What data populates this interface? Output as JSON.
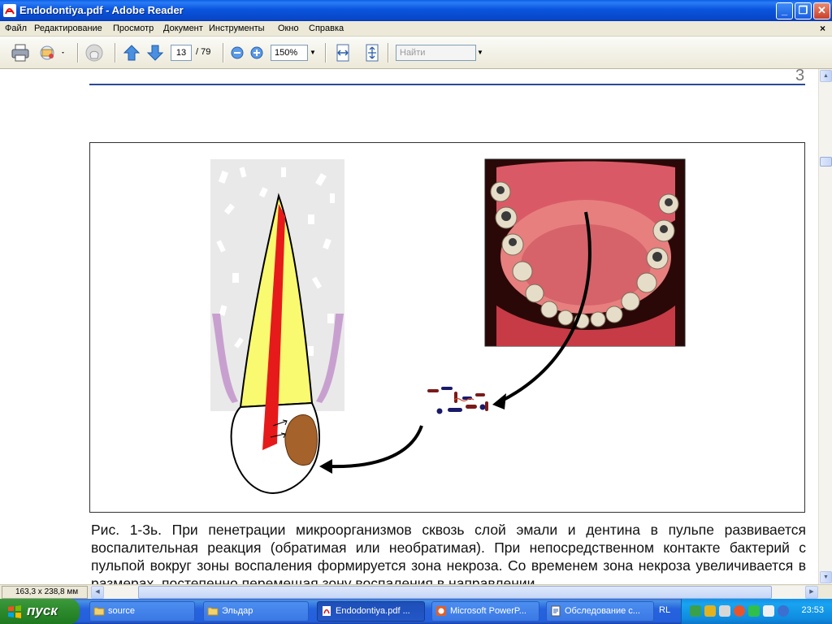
{
  "window": {
    "title": "Endodontiya.pdf - Adobe Reader",
    "buttons": {
      "minimize": "_",
      "maximize": "❐",
      "close": "✕"
    }
  },
  "menu": {
    "items": [
      "Файл",
      "Редактирование",
      "Просмотр",
      "Документ",
      "Инструменты",
      "Окно",
      "Справка"
    ],
    "close": "×"
  },
  "toolbar": {
    "page_current": "13",
    "page_total": "/ 79",
    "zoom": "150%",
    "find_placeholder": "Найти",
    "icons": [
      "printer-icon",
      "email-icon",
      "hand-tool-icon",
      "previous-page-icon",
      "next-page-icon",
      "zoom-out-icon",
      "zoom-in-icon",
      "fit-width-icon",
      "fit-page-icon"
    ]
  },
  "document": {
    "page_number": "3",
    "caption": "Рис. 1-3ь. При пенетрации микроорганизмов сквозь слой эмали и дентина в пульпе развивается воспалительная реакция (обратимая или необратимая). При непосредственном контакте бактерий с пульпой вокруг зоны воспаления формируется зона некроза. Со временем зона некроза увеличивается в размерах, постепенно перемещая зону воспаления в направлении",
    "colors": {
      "rule": "#2b4a95",
      "enamel": "#fafa70",
      "pulp": "#e61a1a",
      "necrosis": "#a5622a",
      "gum": "#c8a0cf"
    }
  },
  "statusbar": {
    "page_size": "163,3 x 238,8 мм"
  },
  "taskbar": {
    "start": "пуск",
    "tasks": [
      {
        "label": "source",
        "icon": "folder-icon",
        "active": false
      },
      {
        "label": "Эльдар",
        "icon": "folder-icon",
        "active": false
      },
      {
        "label": "Endodontiya.pdf ...",
        "icon": "pdf-icon",
        "active": true
      },
      {
        "label": "Microsoft PowerP...",
        "icon": "powerpoint-icon",
        "active": false
      },
      {
        "label": "Обследование с...",
        "icon": "document-icon",
        "active": false
      }
    ],
    "language": "RL",
    "clock": "23:53"
  }
}
